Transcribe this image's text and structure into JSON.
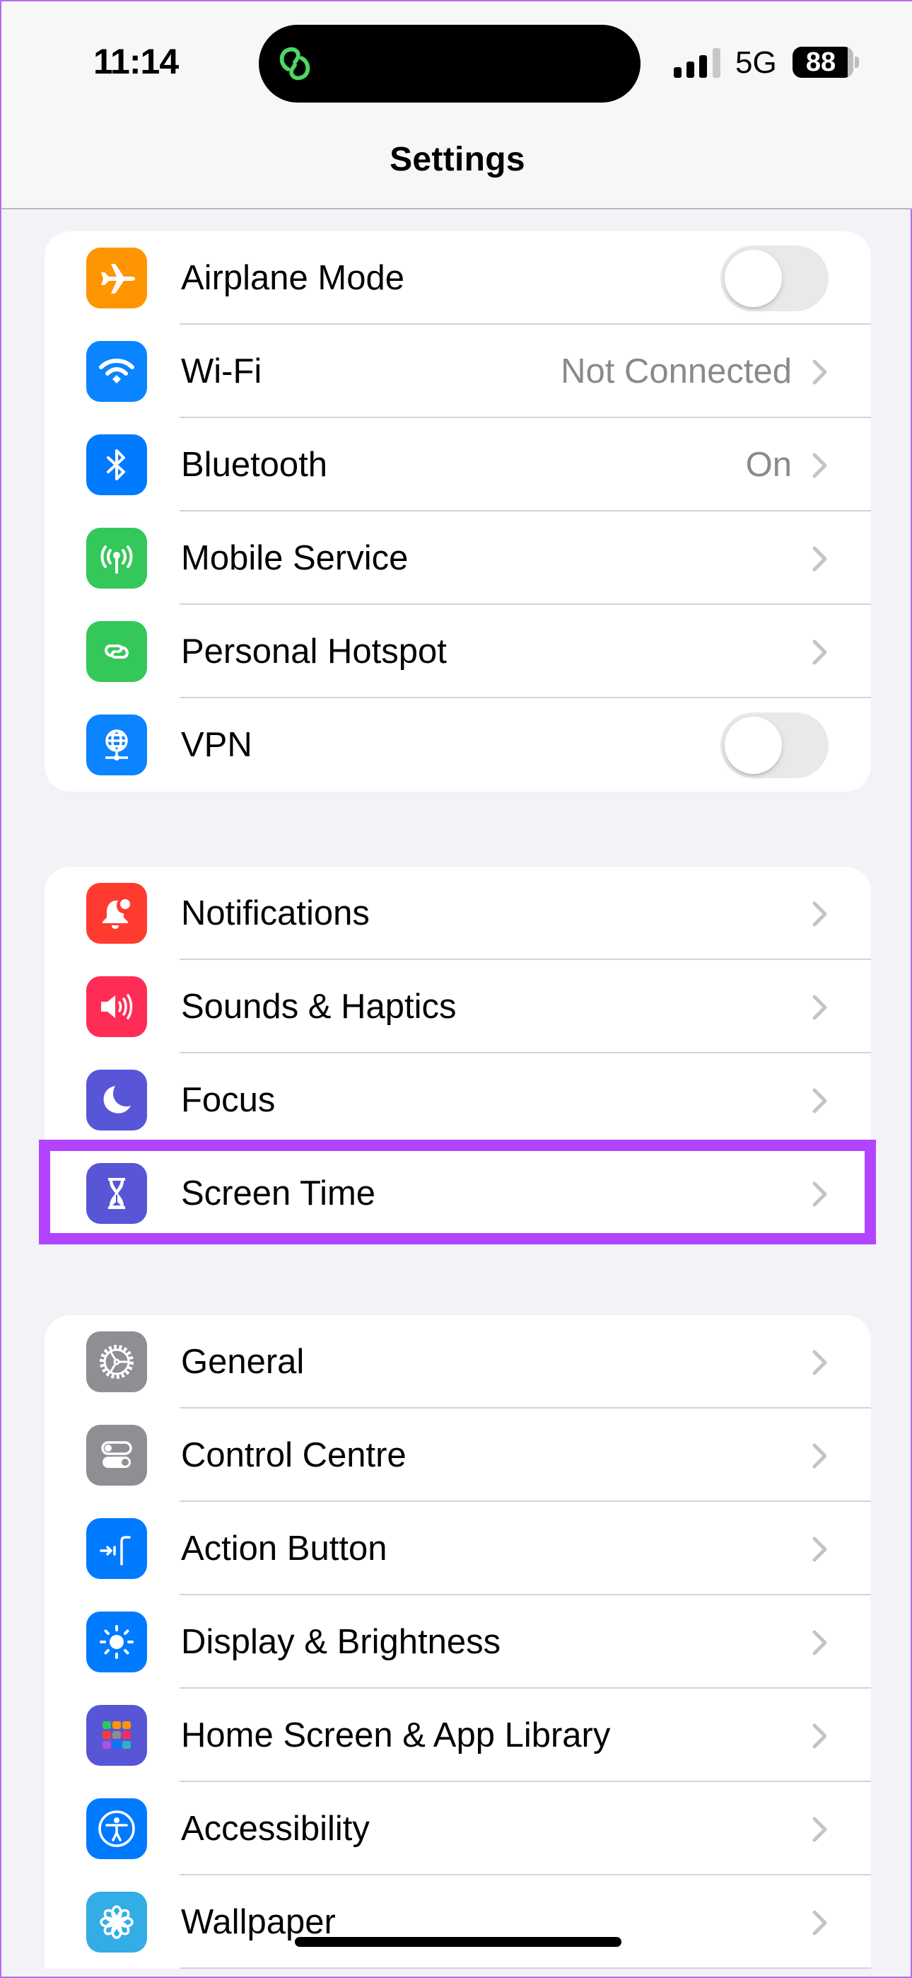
{
  "status_bar": {
    "time": "11:14",
    "network_type": "5G",
    "battery_level": "88",
    "signal_bars_active": 3,
    "signal_bars_total": 4,
    "island_activity_icon": "personal-hotspot-icon",
    "island_activity_color": "#4CD964"
  },
  "nav": {
    "title": "Settings"
  },
  "highlight": {
    "target": "Screen Time",
    "color": "#B244FF"
  },
  "groups": [
    {
      "items": [
        {
          "label": "Airplane Mode",
          "icon": "airplane-icon",
          "icon_bg": "#FF9500",
          "accessory": "toggle",
          "toggle_on": false
        },
        {
          "label": "Wi-Fi",
          "icon": "wifi-icon",
          "icon_bg": "#0A84FF",
          "value": "Not Connected",
          "accessory": "chevron"
        },
        {
          "label": "Bluetooth",
          "icon": "bluetooth-icon",
          "icon_bg": "#007AFF",
          "value": "On",
          "accessory": "chevron"
        },
        {
          "label": "Mobile Service",
          "icon": "antenna-icon",
          "icon_bg": "#34C759",
          "accessory": "chevron"
        },
        {
          "label": "Personal Hotspot",
          "icon": "hotspot-icon",
          "icon_bg": "#34C759",
          "accessory": "chevron"
        },
        {
          "label": "VPN",
          "icon": "vpn-globe-icon",
          "icon_bg": "#0A84FF",
          "accessory": "toggle",
          "toggle_on": false
        }
      ]
    },
    {
      "items": [
        {
          "label": "Notifications",
          "icon": "bell-icon",
          "icon_bg": "#FF3B30",
          "accessory": "chevron"
        },
        {
          "label": "Sounds & Haptics",
          "icon": "speaker-icon",
          "icon_bg": "#FF2D55",
          "accessory": "chevron"
        },
        {
          "label": "Focus",
          "icon": "moon-icon",
          "icon_bg": "#5856D6",
          "accessory": "chevron"
        },
        {
          "label": "Screen Time",
          "icon": "hourglass-icon",
          "icon_bg": "#5856D6",
          "accessory": "chevron"
        }
      ]
    },
    {
      "items": [
        {
          "label": "General",
          "icon": "gear-icon",
          "icon_bg": "#8E8E93",
          "accessory": "chevron"
        },
        {
          "label": "Control Centre",
          "icon": "switches-icon",
          "icon_bg": "#8E8E93",
          "accessory": "chevron"
        },
        {
          "label": "Action Button",
          "icon": "action-button-icon",
          "icon_bg": "#007AFF",
          "accessory": "chevron"
        },
        {
          "label": "Display & Brightness",
          "icon": "sun-icon",
          "icon_bg": "#007AFF",
          "accessory": "chevron"
        },
        {
          "label": "Home Screen & App Library",
          "icon": "app-grid-icon",
          "icon_bg": "#5856D6",
          "accessory": "chevron"
        },
        {
          "label": "Accessibility",
          "icon": "accessibility-icon",
          "icon_bg": "#007AFF",
          "accessory": "chevron"
        },
        {
          "label": "Wallpaper",
          "icon": "flower-icon",
          "icon_bg": "#32ADE6",
          "accessory": "chevron"
        }
      ]
    }
  ]
}
